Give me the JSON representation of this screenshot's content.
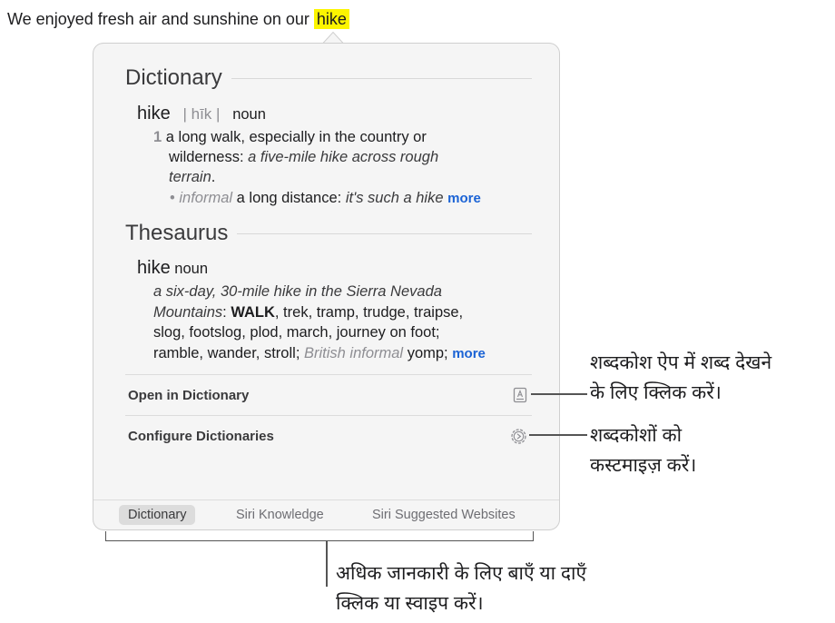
{
  "sentence": {
    "prefix": "We enjoyed fresh air and sunshine on our ",
    "highlight": "hike",
    "highlight_color": "#fcf500"
  },
  "dictionary": {
    "heading": "Dictionary",
    "headword": "hike",
    "pronunciation": "| hīk |",
    "pos": "noun",
    "sense_number": "1",
    "def_line1": "a long walk, especially in the country or",
    "def_line2_plain": "wilderness: ",
    "def_line2_example": "a five-mile hike across rough",
    "def_line3_example": "terrain",
    "def_line3_end": ".",
    "sub_bullet": "•",
    "sub_register": "informal",
    "sub_def": " a long distance: ",
    "sub_example": "it's such a hike",
    "more": "more"
  },
  "thesaurus": {
    "heading": "Thesaurus",
    "headword": "hike",
    "pos": "noun",
    "line1_example": "a six-day, 30-mile hike in the Sierra Nevada",
    "line2_example": "Mountains",
    "line2_colon": ": ",
    "line2_main": "WALK",
    "line2_rest": ", trek, tramp, trudge, traipse,",
    "line3": "slog, footslog, plod, march, journey on foot;",
    "line4_plain": "ramble, wander, stroll; ",
    "line4_register": "British informal",
    "line4_end": " yomp; ",
    "more": "more"
  },
  "actions": {
    "open_dictionary": "Open in Dictionary",
    "open_icon": "dictionary-book-icon",
    "configure": "Configure Dictionaries",
    "configure_icon": "gear-icon"
  },
  "tabs": [
    {
      "label": "Dictionary",
      "selected": true
    },
    {
      "label": "Siri Knowledge",
      "selected": false
    },
    {
      "label": "Siri Suggested Websites",
      "selected": false
    }
  ],
  "callouts": {
    "open_line1": "शब्दकोश ऐप में शब्द देखने",
    "open_line2": "के लिए क्लिक करें।",
    "configure_line1": "शब्दकोशों को",
    "configure_line2": "कस्टमाइज़ करें।",
    "tabs_line1": "अधिक जानकारी के लिए बाएँ या दाएँ",
    "tabs_line2": "क्लिक या स्वाइप करें।"
  },
  "colors": {
    "link": "#1b63d5",
    "popover_bg": "#f5f5f5",
    "selected_tab_bg": "#dcdcdc"
  }
}
